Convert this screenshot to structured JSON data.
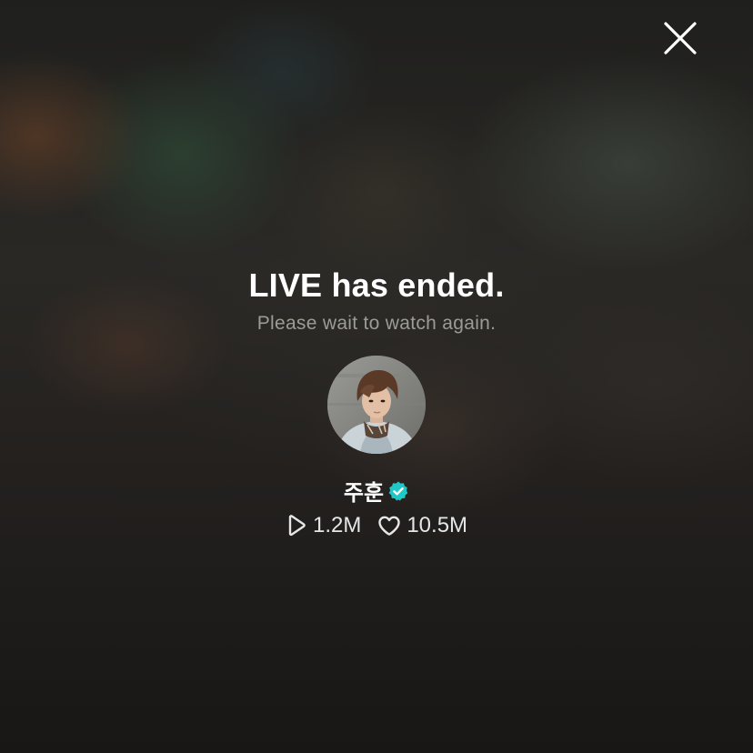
{
  "screen": {
    "title": "LIVE has ended.",
    "subtitle": "Please wait to watch again."
  },
  "close_button": {
    "icon": "close-icon"
  },
  "artist": {
    "name": "주훈",
    "verified_icon": "verified-badge-icon",
    "avatar_icon": "avatar"
  },
  "stats": {
    "plays": {
      "icon": "play-icon",
      "value": "1.2M"
    },
    "likes": {
      "icon": "heart-icon",
      "value": "10.5M"
    }
  },
  "colors": {
    "verified": "#1ec8c8",
    "title": "#ffffff",
    "subtitle": "#9d9b98"
  }
}
